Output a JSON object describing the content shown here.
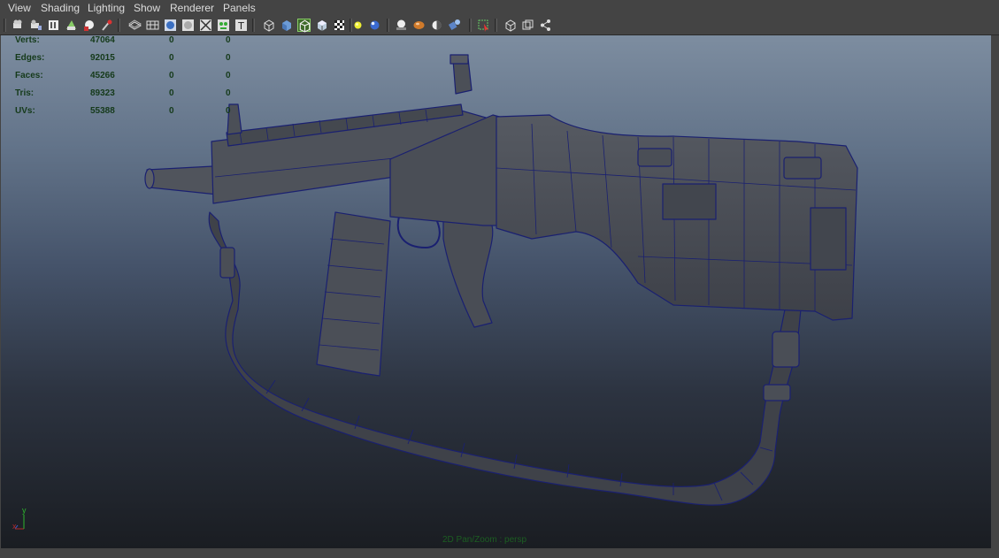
{
  "menubar": {
    "items": [
      "View",
      "Shading",
      "Lighting",
      "Show",
      "Renderer",
      "Panels"
    ]
  },
  "toolbar": {
    "icons": [
      "select-camera-icon",
      "camera-attributes-icon",
      "bookmarks-icon",
      "image-plane-icon",
      "grid-icon",
      "film-gate-icon",
      "resolution-gate-icon",
      "gate-mask-icon",
      "field-chart-icon",
      "safe-action-icon",
      "safe-title-icon",
      "wireframe-icon",
      "smooth-shade-icon",
      "bounding-box-icon",
      "points-icon",
      "flat-shade-icon",
      "default-material-icon",
      "wireframe-on-shaded-icon",
      "xray-icon",
      "textured-icon",
      "use-all-lights-icon",
      "shadows-icon",
      "screen-space-ao-icon",
      "motion-blur-icon",
      "multisample-aa-icon",
      "depth-of-field-icon",
      "isolate-select-icon",
      "xray-joints-icon",
      "xray-active-components-icon",
      "hud-toggle-icon"
    ]
  },
  "hud": {
    "rows": [
      {
        "label": "Verts:",
        "v1": "47064",
        "v2": "0",
        "v3": "0"
      },
      {
        "label": "Edges:",
        "v1": "92015",
        "v2": "0",
        "v3": "0"
      },
      {
        "label": "Faces:",
        "v1": "45266",
        "v2": "0",
        "v3": "0"
      },
      {
        "label": "Tris:",
        "v1": "89323",
        "v2": "0",
        "v3": "0"
      },
      {
        "label": "UVs:",
        "v1": "55388",
        "v2": "0",
        "v3": "0"
      }
    ]
  },
  "camera_status": "2D Pan/Zoom : persp",
  "axis": {
    "y": "y",
    "x": "x"
  },
  "colors": {
    "wire": "#1a2070",
    "mesh": "#4b4f57",
    "hud_text": "#153a1a",
    "camera_text": "#1c5e22"
  }
}
